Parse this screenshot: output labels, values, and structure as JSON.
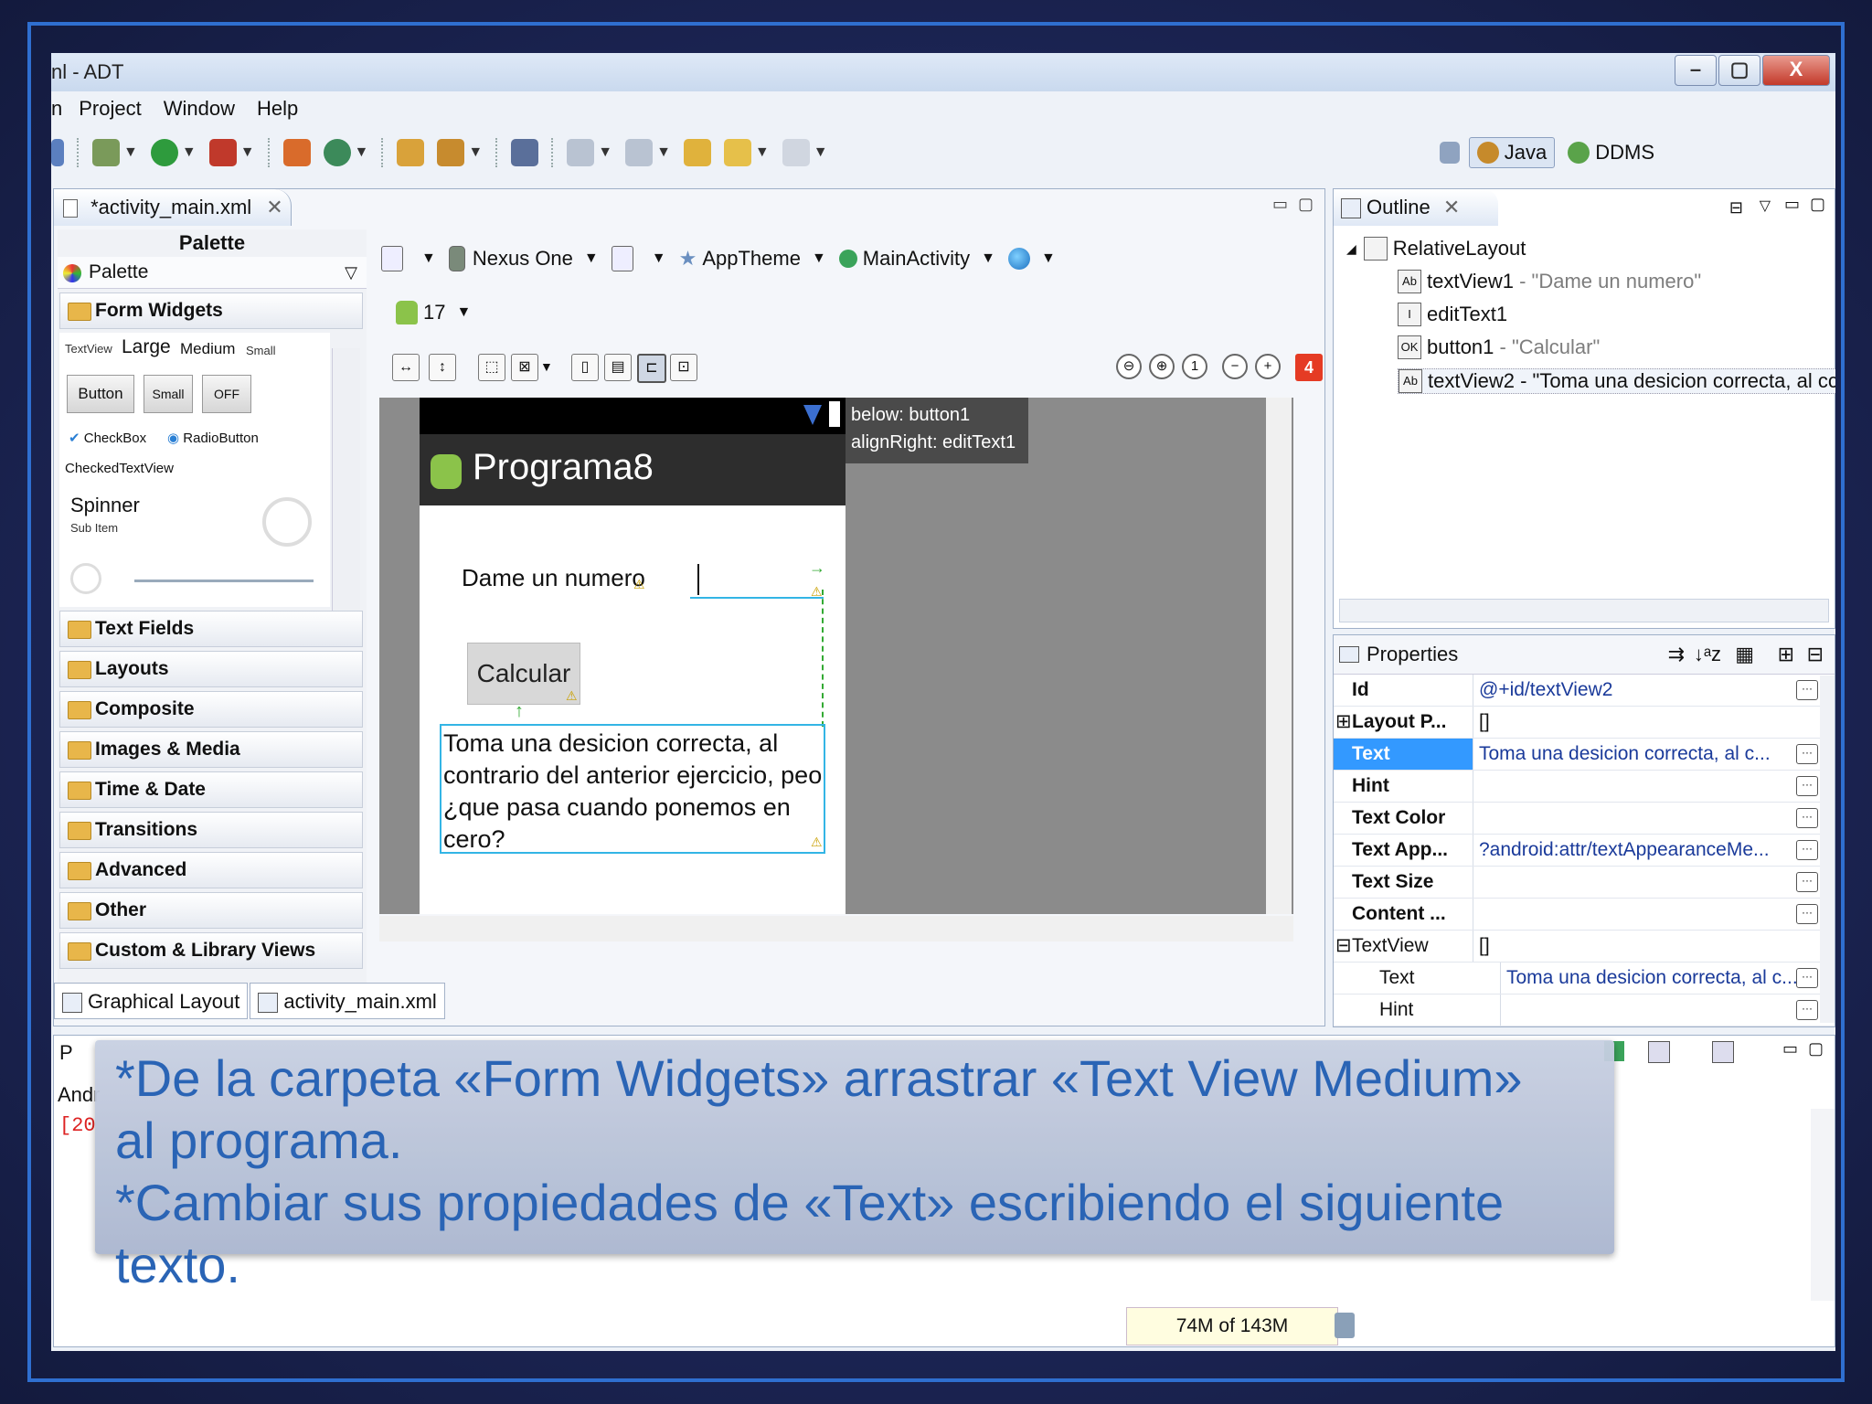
{
  "window": {
    "title": "nl - ADT",
    "faded_title": "",
    "menu": [
      "n",
      "Project",
      "Window",
      "Help"
    ],
    "controls": {
      "minimize": "–",
      "maximize": "▢",
      "close": "X"
    }
  },
  "perspectives": [
    {
      "label": "Java",
      "active": true,
      "color": "#c68a2b"
    },
    {
      "label": "DDMS",
      "active": false,
      "color": "#5aa34a"
    }
  ],
  "editor": {
    "tab_label": "*activity_main.xml",
    "palette": {
      "header": "Palette",
      "sub": "Palette",
      "open_folder": "Form Widgets",
      "widgets": {
        "textview_small": "TextView",
        "large": "Large",
        "medium": "Medium",
        "small": "Small",
        "button": "Button",
        "small_btn": "Small",
        "toggle_off": "OFF",
        "checkbox": "CheckBox",
        "radiobutton": "RadioButton",
        "checkedtextview": "CheckedTextView",
        "spinner": "Spinner",
        "sub_item": "Sub Item"
      },
      "folders": [
        "Text Fields",
        "Layouts",
        "Composite",
        "Images & Media",
        "Time & Date",
        "Transitions",
        "Advanced",
        "Other",
        "Custom & Library Views"
      ]
    },
    "layout_toolbar": {
      "device": "Nexus One",
      "theme": "AppTheme",
      "activity": "MainActivity",
      "api_level": "17",
      "error_count": "4"
    },
    "device_preview": {
      "app_title": "Programa8",
      "label": "Dame un numero",
      "button": "Calcular",
      "textview": "Toma una desicion correcta, al contrario del anterior ejercicio, peo ¿que pasa cuando ponemos en cero?",
      "hint_line1": "below: button1",
      "hint_line2": "alignRight: editText1"
    },
    "bottom_tabs": [
      "Graphical Layout",
      "activity_main.xml"
    ]
  },
  "outline": {
    "tab_label": "Outline",
    "root": "RelativeLayout",
    "items": [
      {
        "icon": "Ab",
        "id": "textView1",
        "detail": "- \"Dame un numero\""
      },
      {
        "icon": "I",
        "id": "editText1",
        "detail": ""
      },
      {
        "icon": "OK",
        "id": "button1",
        "detail": "- \"Calcular\""
      },
      {
        "icon": "Ab",
        "id": "textView2",
        "detail": "- \"Toma una desicion correcta, al cc"
      }
    ]
  },
  "properties": {
    "header": "Properties",
    "rows": [
      {
        "key": "Id",
        "value": "@+id/textView2",
        "selected": false
      },
      {
        "key": "Layout P...",
        "value": "[]",
        "selected": false
      },
      {
        "key": "Text",
        "value": "Toma una desicion correcta, al c...",
        "selected": true
      },
      {
        "key": "Hint",
        "value": "",
        "selected": false
      },
      {
        "key": "Text Color",
        "value": "",
        "selected": false
      },
      {
        "key": "Text App...",
        "value": "?android:attr/textAppearanceMe...",
        "selected": false
      },
      {
        "key": "Text Size",
        "value": "",
        "selected": false
      },
      {
        "key": "Content ...",
        "value": "",
        "selected": false
      },
      {
        "key": "TextView",
        "value": "[]",
        "selected": false
      },
      {
        "key": "Text",
        "value": "Toma una desicion correcta, al c...",
        "selected": false
      },
      {
        "key": "Hint",
        "value": "",
        "selected": false
      }
    ]
  },
  "console": {
    "tab_partial": "P",
    "andr": "Andr",
    "log": "[20"
  },
  "status": {
    "memory": "74M of 143M"
  },
  "caption": {
    "line1": "*De la carpeta «Form Widgets» arrastrar «Text View Medium»",
    "line2": "al programa.",
    "line3": "*Cambiar sus propiedades de «Text» escribiendo el siguiente",
    "line4": "texto."
  }
}
